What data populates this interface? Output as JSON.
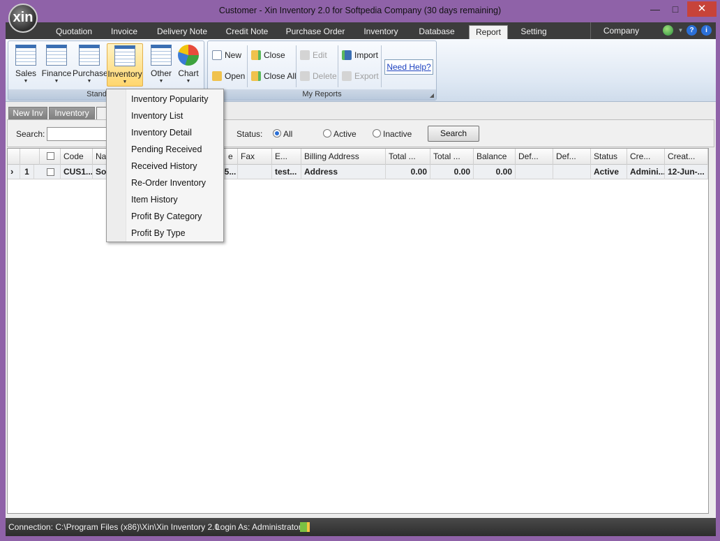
{
  "window": {
    "title": "Customer - Xin Inventory 2.0 for Softpedia Company (30 days remaining)",
    "logo_text": "xin",
    "min_glyph": "—",
    "max_glyph": "□",
    "close_glyph": "✕"
  },
  "main_tabs": [
    "Quotation",
    "Invoice",
    "Delivery Note",
    "Credit Note",
    "Purchase Order",
    "Inventory",
    "Database",
    "Report",
    "Setting"
  ],
  "active_main_tab": "Report",
  "company_tab": "Company",
  "ribbon": {
    "standard_group": {
      "label": "Standard R",
      "buttons": [
        "Sales",
        "Finance",
        "Purchase",
        "Inventory",
        "Other",
        "Chart"
      ]
    },
    "my_reports_group": {
      "label": "My Reports",
      "new": "New",
      "open": "Open",
      "close": "Close",
      "close_all": "Close All",
      "edit": "Edit",
      "delete": "Delete",
      "import": "Import",
      "export": "Export",
      "help": "Need Help?"
    }
  },
  "doc_tabs": [
    "New Inv",
    "Inventory",
    "C"
  ],
  "search": {
    "label": "Search:",
    "value": "",
    "status_label": "Status:",
    "status_options": [
      "All",
      "Active",
      "Inactive"
    ],
    "selected_status": "All",
    "button": "Search"
  },
  "grid": {
    "columns": [
      "",
      "",
      "Code",
      "Na",
      "e",
      "Fax",
      "E...",
      "Billing Address",
      "Total ...",
      "Total ...",
      "Balance",
      "Def...",
      "Def...",
      "Status",
      "Cre...",
      "Creat..."
    ],
    "rows": [
      {
        "indicator": "›",
        "no": "1",
        "code": "CUS1...",
        "name": "So",
        "phone": "35...",
        "fax": "",
        "email": "test...",
        "billing_address": "Address",
        "total1": "0.00",
        "total2": "0.00",
        "balance": "0.00",
        "def1": "",
        "def2": "",
        "status": "Active",
        "created_by": "Admini...",
        "created_date": "12-Jun-..."
      }
    ]
  },
  "inventory_menu": [
    "Inventory Popularity",
    "Inventory List",
    "Inventory Detail",
    "Pending Received",
    "Received History",
    "Re-Order Inventory",
    "Item History",
    "Profit By Category",
    "Profit By Type"
  ],
  "statusbar": {
    "connection": "Connection: C:\\Program Files (x86)\\Xin\\Xin Inventory 2.0",
    "login": "Login As: Administrator"
  },
  "colors": {
    "frame": "#8f62a8",
    "close_button": "#c7433a",
    "tab_strip": "#3c3c3c",
    "link": "#1a3fbf"
  }
}
